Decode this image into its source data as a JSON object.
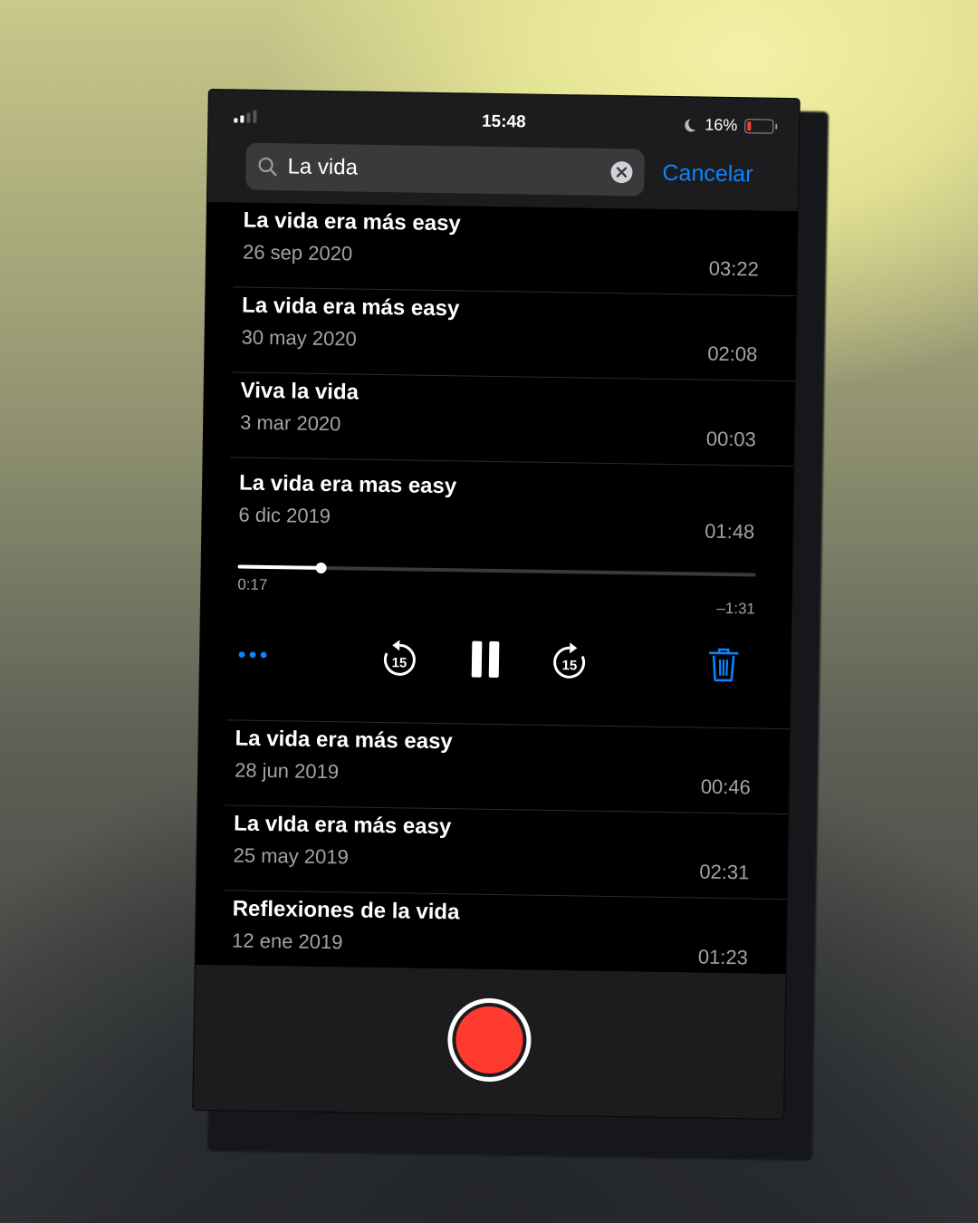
{
  "status": {
    "time": "15:48",
    "battery": "16%",
    "battery_level": 0.16
  },
  "search": {
    "query": "La vida",
    "cancel_label": "Cancelar"
  },
  "recordings": [
    {
      "title": "La vida era más easy",
      "date": "26 sep 2020",
      "duration": "03:22"
    },
    {
      "title": "La vida era más easy",
      "date": "30 may 2020",
      "duration": "02:08"
    },
    {
      "title": "Viva la vida",
      "date": "3 mar 2020",
      "duration": "00:03"
    }
  ],
  "playing": {
    "title": "La vida era mas easy",
    "date": "6 dic 2019",
    "duration": "01:48",
    "elapsed": "0:17",
    "remaining": "–1:31",
    "progress": 0.16,
    "skip_back_seconds": "15",
    "skip_forward_seconds": "15"
  },
  "recordings_after": [
    {
      "title": "La vida era más easy",
      "date": "28 jun 2019",
      "duration": "00:46"
    },
    {
      "title": "La vIda era más easy",
      "date": "25 may 2019",
      "duration": "02:31"
    },
    {
      "title": "Reflexiones de la vida",
      "date": "12 ene 2019",
      "duration": "01:23"
    }
  ],
  "colors": {
    "accent": "#0a84ff",
    "record": "#ff3b30",
    "background": "#000000",
    "bar": "#1c1c1e"
  }
}
